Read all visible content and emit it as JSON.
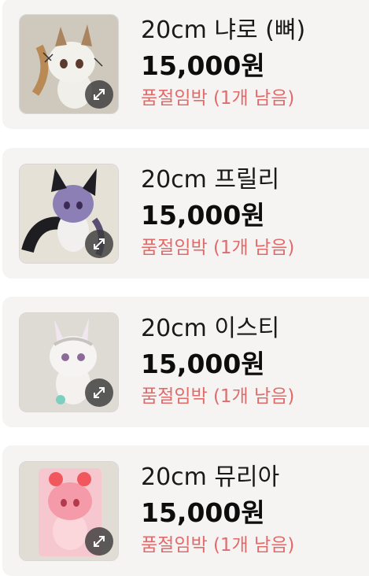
{
  "products": [
    {
      "name": "20cm 냐로 (뼈)",
      "price": "15,000원",
      "stock": "품절임박 (1개 남음)"
    },
    {
      "name": "20cm 프릴리",
      "price": "15,000원",
      "stock": "품절임박 (1개 남음)"
    },
    {
      "name": "20cm 이스티",
      "price": "15,000원",
      "stock": "품절임박 (1개 남음)"
    },
    {
      "name": "20cm 뮤리아",
      "price": "15,000원",
      "stock": "품절임박 (1개 남음)"
    }
  ],
  "icons": {
    "expand": "expand-arrows-icon"
  },
  "colors": {
    "stock_warning": "#e06b6b",
    "card_bg": "#f5f4f3"
  }
}
